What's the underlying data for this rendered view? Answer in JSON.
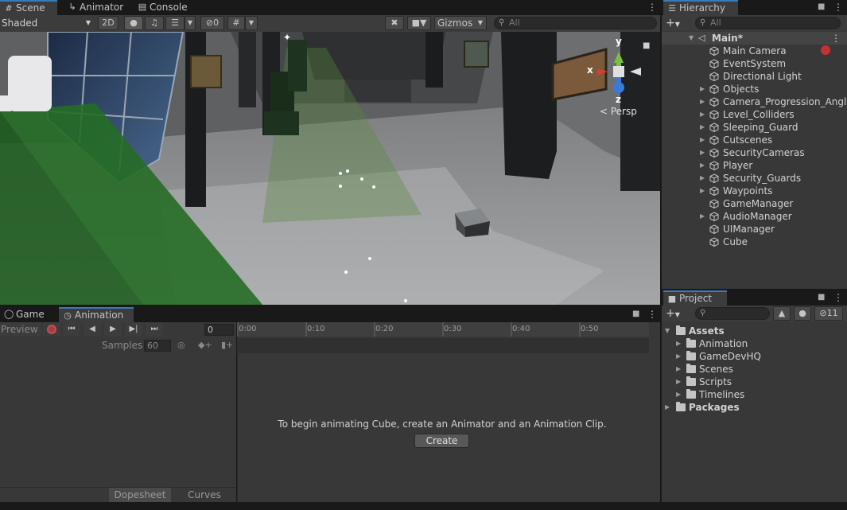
{
  "scene": {
    "tabs": [
      {
        "label": "Scene",
        "icon": "grid-icon",
        "active": true
      },
      {
        "label": "Animator",
        "icon": "animator-icon",
        "active": false
      },
      {
        "label": "Console",
        "icon": "console-icon",
        "active": false
      }
    ],
    "shading_mode": "Shaded",
    "mode_2d_label": "2D",
    "hidden_count": "0",
    "gizmos_label": "Gizmos",
    "search_placeholder": "All",
    "axis_labels": {
      "y": "y",
      "x": "x",
      "z": "z"
    },
    "projection_label": "< Persp"
  },
  "hierarchy": {
    "tab_label": "Hierarchy",
    "search_placeholder": "All",
    "scene_name": "Main*",
    "items": [
      {
        "label": "Main Camera",
        "expandable": false
      },
      {
        "label": "EventSystem",
        "expandable": false
      },
      {
        "label": "Directional Light",
        "expandable": false
      },
      {
        "label": "Objects",
        "expandable": true
      },
      {
        "label": "Camera_Progression_Angles",
        "expandable": true
      },
      {
        "label": "Level_Colliders",
        "expandable": true
      },
      {
        "label": "Sleeping_Guard",
        "expandable": true
      },
      {
        "label": "Cutscenes",
        "expandable": true
      },
      {
        "label": "SecurityCameras",
        "expandable": true
      },
      {
        "label": "Player",
        "expandable": true
      },
      {
        "label": "Security_Guards",
        "expandable": true
      },
      {
        "label": "Waypoints",
        "expandable": true
      },
      {
        "label": "GameManager",
        "expandable": false
      },
      {
        "label": "AudioManager",
        "expandable": true
      },
      {
        "label": "UIManager",
        "expandable": false
      },
      {
        "label": "Cube",
        "expandable": false
      }
    ]
  },
  "project": {
    "tab_label": "Project",
    "hidden_count": "11",
    "assets_label": "Assets",
    "asset_folders": [
      "Animation",
      "GameDevHQ",
      "Scenes",
      "Scripts",
      "Timelines"
    ],
    "packages_label": "Packages"
  },
  "animation": {
    "tabs": [
      {
        "label": "Game",
        "icon": "gamepad-icon",
        "active": false
      },
      {
        "label": "Animation",
        "icon": "clock-icon",
        "active": true
      }
    ],
    "preview_label": "Preview",
    "frame_value": "0",
    "samples_label": "Samples",
    "samples_value": "60",
    "timeline_ticks": [
      "0:00",
      "0:10",
      "0:20",
      "0:30",
      "0:40",
      "0:50"
    ],
    "message": "To begin animating Cube, create an Animator and an Animation Clip.",
    "create_label": "Create",
    "dopesheet_label": "Dopesheet",
    "curves_label": "Curves"
  },
  "colors": {
    "accent": "#3a79bb",
    "panel": "#383838",
    "toolbar": "#3c3c3c",
    "record": "#c0504d"
  }
}
